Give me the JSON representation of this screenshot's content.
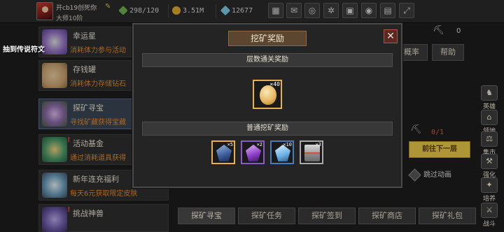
{
  "player": {
    "name": "开cb19创死你",
    "rank": "大师10阶"
  },
  "resources": {
    "stamina": "298/120",
    "gold": "3.51M",
    "gems": "12677"
  },
  "topbar_icons": [
    "shop-icon",
    "mail-icon",
    "gamepad-icon",
    "gear-icon",
    "gift-icon",
    "wheel-icon",
    "grid-icon",
    "fullscreen-icon"
  ],
  "floating_label": "抽到传说符文",
  "events": [
    {
      "title": "幸运星",
      "desc": "消耗体力参与活动",
      "badge": ""
    },
    {
      "title": "存钱罐",
      "desc": "消耗体力存储钻石",
      "badge": ""
    },
    {
      "title": "探矿寻宝",
      "desc": "寻找矿藏获得宝藏",
      "badge": ""
    },
    {
      "title": "活动基金",
      "desc": "通过消耗道具获得",
      "badge": "!"
    },
    {
      "title": "新年连充福利",
      "desc": "每天6元获取限定皮肤",
      "badge": ""
    },
    {
      "title": "挑战神兽",
      "desc": "",
      "badge": "!"
    }
  ],
  "right_panel": {
    "pick_count": "0",
    "prob_button": "概率",
    "help_button": "帮助",
    "floor_progress": "0/1",
    "next_floor_button": "前往下一层",
    "skip_animation": "跳过动画"
  },
  "side_buttons": [
    {
      "label": "英雄",
      "icon": "hero-icon"
    },
    {
      "label": "领地",
      "icon": "territory-icon"
    },
    {
      "label": "集市",
      "icon": "market-icon"
    },
    {
      "label": "强化",
      "icon": "upgrade-icon"
    },
    {
      "label": "培养",
      "icon": "train-icon"
    },
    {
      "label": "战斗",
      "icon": "battle-icon"
    }
  ],
  "bottom_tabs": [
    "探矿寻宝",
    "探矿任务",
    "探矿签到",
    "探矿商店",
    "探矿礼包"
  ],
  "modal": {
    "title": "挖矿奖励",
    "close": "✕",
    "section1": "层数通关奖励",
    "section1_rewards": [
      {
        "name": "golden-egg",
        "qty": "×40"
      }
    ],
    "section2": "普通挖矿奖励",
    "section2_rewards": [
      {
        "name": "blue-ore",
        "qty": "×5"
      },
      {
        "name": "purple-crystal",
        "qty": "×2"
      },
      {
        "name": "ice-crystal",
        "qty": "×10"
      },
      {
        "name": "treasure-chest",
        "qty": "×3"
      }
    ]
  },
  "colors": {
    "accent_orange": "#e28a2c",
    "gold_button": "#e8c84a",
    "alert_red": "#e8443a"
  }
}
